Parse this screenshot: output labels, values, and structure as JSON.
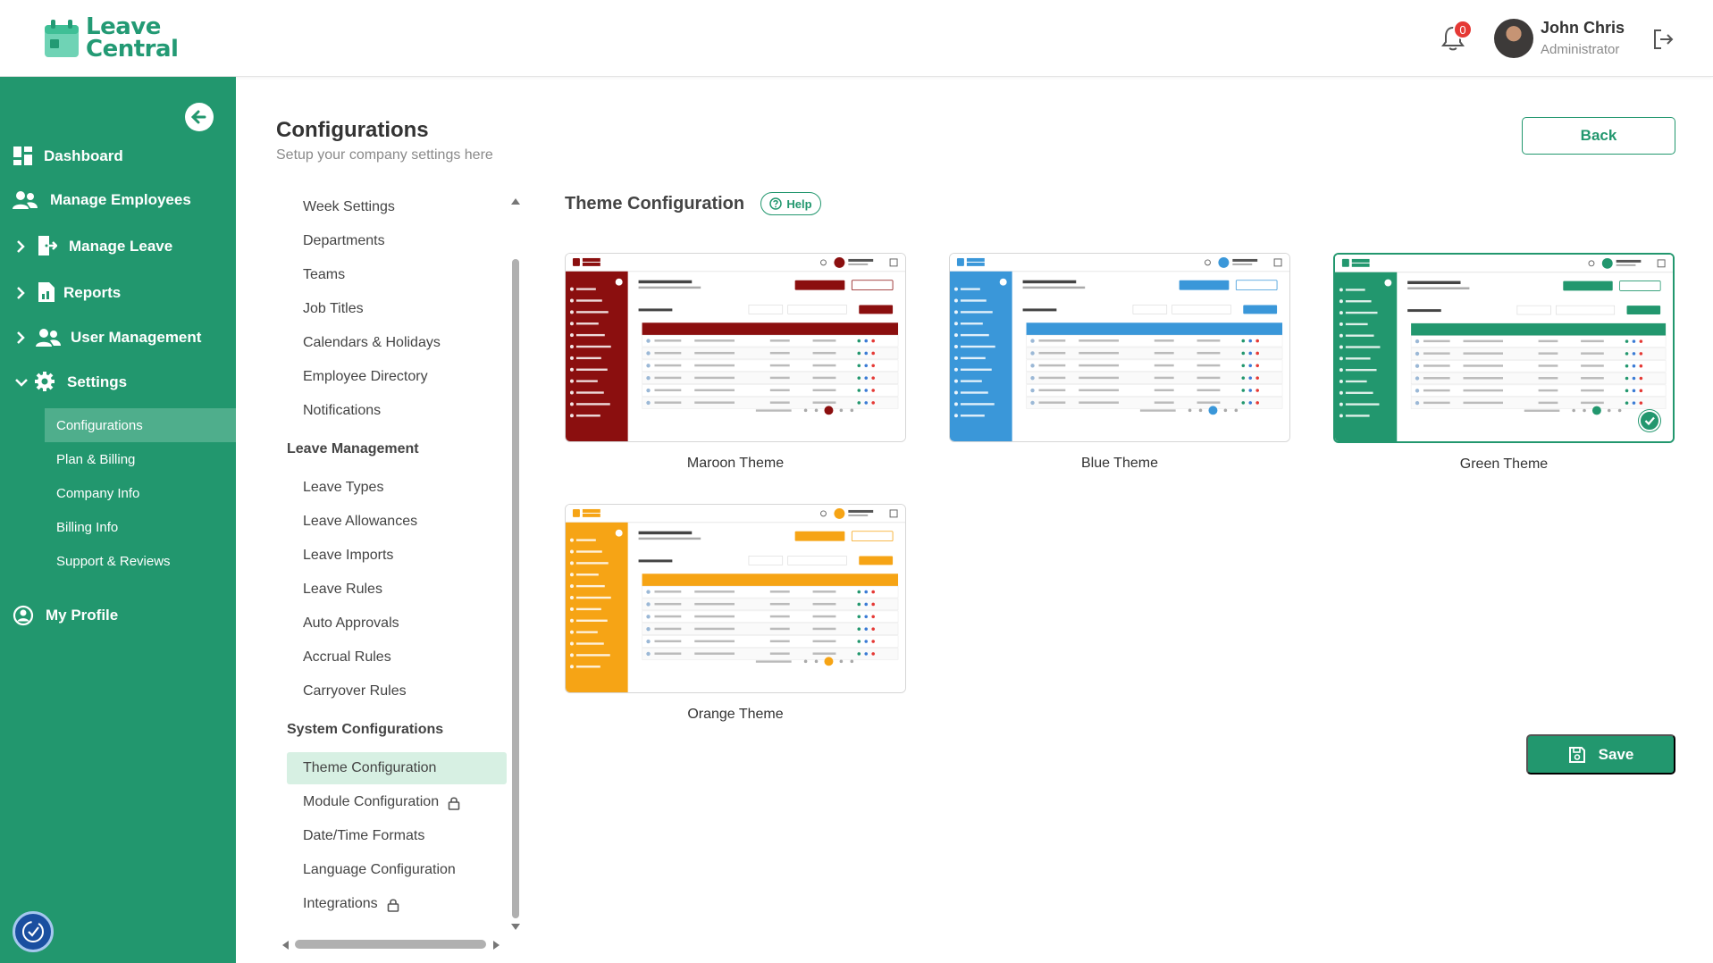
{
  "app": {
    "logo_line1": "Leave",
    "logo_line2": "Central"
  },
  "header": {
    "notification_count": "0",
    "user_name": "John Chris",
    "user_role": "Administrator"
  },
  "sidebar": {
    "items": [
      {
        "label": "Dashboard"
      },
      {
        "label": "Manage Employees"
      },
      {
        "label": "Manage Leave"
      },
      {
        "label": "Reports"
      },
      {
        "label": "User Management"
      },
      {
        "label": "Settings"
      },
      {
        "label": "My Profile"
      }
    ],
    "settings_sub": [
      {
        "label": "Configurations"
      },
      {
        "label": "Plan & Billing"
      },
      {
        "label": "Company Info"
      },
      {
        "label": "Billing Info"
      },
      {
        "label": "Support & Reviews"
      }
    ]
  },
  "page": {
    "title": "Configurations",
    "subtitle": "Setup your company settings here",
    "back_label": "Back",
    "save_label": "Save"
  },
  "menu": {
    "general": [
      "Week Settings",
      "Departments",
      "Teams",
      "Job Titles",
      "Calendars & Holidays",
      "Employee Directory",
      "Notifications"
    ],
    "leave_heading": "Leave Management",
    "leave": [
      "Leave Types",
      "Leave Allowances",
      "Leave Imports",
      "Leave Rules",
      "Auto Approvals",
      "Accrual Rules",
      "Carryover Rules"
    ],
    "system_heading": "System Configurations",
    "system": [
      "Theme Configuration",
      "Module Configuration",
      "Date/Time Formats",
      "Language Configuration",
      "Integrations"
    ]
  },
  "theme": {
    "title": "Theme Configuration",
    "help_label": "Help",
    "options": [
      {
        "label": "Maroon Theme",
        "color": "#8b0f0f"
      },
      {
        "label": "Blue Theme",
        "color": "#3a97d9"
      },
      {
        "label": "Green Theme",
        "color": "#22976e"
      },
      {
        "label": "Orange Theme",
        "color": "#f6a415"
      }
    ],
    "selected": "Green Theme"
  },
  "colors": {
    "brand": "#22976e",
    "active_sub": "#4fae8c",
    "menu_active": "#d7f0e3"
  }
}
